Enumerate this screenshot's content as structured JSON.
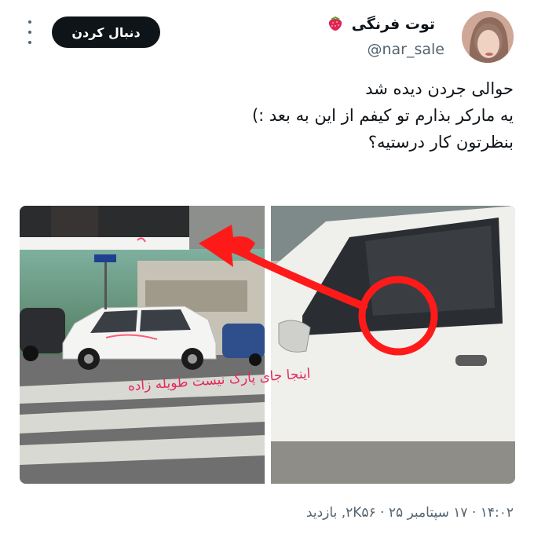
{
  "user": {
    "display_name": "توت فرنگی",
    "name_emoji": "strawberry-emoji",
    "handle": "@nar_sale"
  },
  "actions": {
    "follow_label": "دنبال کردن"
  },
  "tweet": {
    "lines": [
      "حوالی جردن دیده شد",
      "یه مارکر بذارم تو کیفم از این به بعد :)",
      "بنظرتون کار درستیه؟"
    ]
  },
  "media": {
    "car_graffiti_text": "اینجا جای پارک نیست طویله زاده"
  },
  "meta": {
    "timestamp_line": "۱۴:۰۲ · ۱۷ سپتامبر ۲۵ · ۲K۵۶, بازدید"
  },
  "colors": {
    "text_primary": "#0f1419",
    "text_secondary": "#536471",
    "button_bg": "#0f1419",
    "annotation_red": "#ff1a1a"
  }
}
